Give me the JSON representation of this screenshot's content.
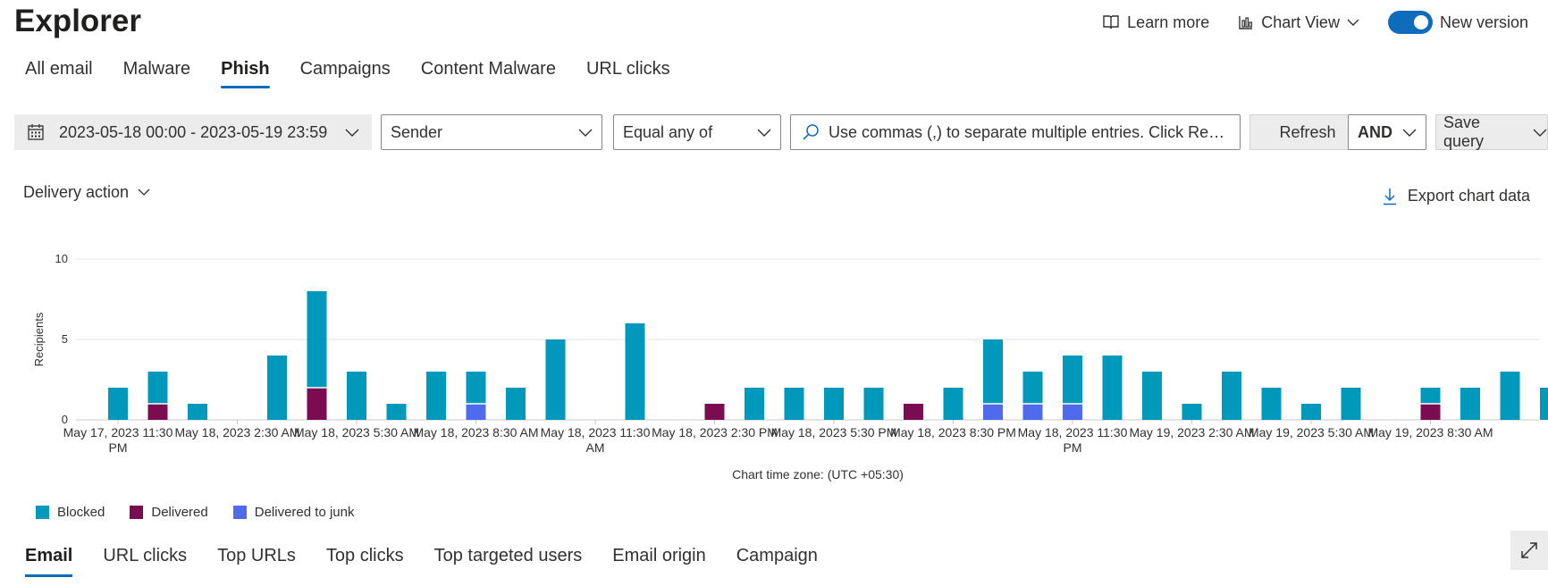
{
  "header": {
    "title": "Explorer"
  },
  "top_actions": {
    "learn_more": "Learn more",
    "chart_view": "Chart View",
    "new_version": "New version"
  },
  "tabs": [
    {
      "label": "All email"
    },
    {
      "label": "Malware"
    },
    {
      "label": "Phish",
      "active": true
    },
    {
      "label": "Campaigns"
    },
    {
      "label": "Content Malware"
    },
    {
      "label": "URL clicks"
    }
  ],
  "filters": {
    "date_range": "2023-05-18 00:00 - 2023-05-19 23:59",
    "field": "Sender",
    "operator": "Equal any of",
    "search_text": "Use commas (,) to separate multiple entries. Click Refresh to apply.",
    "refresh": "Refresh",
    "logic": "AND",
    "save_query": "Save query"
  },
  "chart_header": {
    "group_by": "Delivery action",
    "export": "Export chart data"
  },
  "colors": {
    "blocked": "#0199bb",
    "delivered": "#7a0d52",
    "delivered_to_junk": "#4f6bed",
    "accent": "#0f6cbd"
  },
  "chart_data": {
    "type": "bar",
    "stacked": true,
    "ylabel": "Recipients",
    "ylim": [
      0,
      10
    ],
    "yticks": [
      0,
      5,
      10
    ],
    "xtick_labels": [
      {
        "at": 0,
        "lines": [
          "May 17, 2023 11:30",
          "PM"
        ]
      },
      {
        "at": 3,
        "lines": [
          "May 18, 2023 2:30 AM"
        ]
      },
      {
        "at": 6,
        "lines": [
          "May 18, 2023 5:30 AM"
        ]
      },
      {
        "at": 9,
        "lines": [
          "May 18, 2023 8:30 AM"
        ]
      },
      {
        "at": 12,
        "lines": [
          "May 18, 2023 11:30",
          "AM"
        ]
      },
      {
        "at": 15,
        "lines": [
          "May 18, 2023 2:30 PM"
        ]
      },
      {
        "at": 18,
        "lines": [
          "May 18, 2023 5:30 PM"
        ]
      },
      {
        "at": 21,
        "lines": [
          "May 18, 2023 8:30 PM"
        ]
      },
      {
        "at": 24,
        "lines": [
          "May 18, 2023 11:30",
          "PM"
        ]
      },
      {
        "at": 27,
        "lines": [
          "May 19, 2023 2:30 AM"
        ]
      },
      {
        "at": 30,
        "lines": [
          "May 19, 2023 5:30 AM"
        ]
      },
      {
        "at": 33,
        "lines": [
          "May 19, 2023 8:30 AM"
        ]
      }
    ],
    "timezone_note": "Chart time zone: (UTC +05:30)",
    "categories": [
      "May 17 11:30 PM",
      "May 18 12:30 AM",
      "May 18 1:30 AM",
      "May 18 2:30 AM",
      "May 18 3:30 AM",
      "May 18 4:30 AM",
      "May 18 5:30 AM",
      "May 18 6:30 AM",
      "May 18 7:30 AM",
      "May 18 8:30 AM",
      "May 18 9:30 AM",
      "May 18 10:30 AM",
      "May 18 11:30 AM",
      "May 18 12:30 PM",
      "May 18 1:30 PM",
      "May 18 2:30 PM",
      "May 18 3:30 PM",
      "May 18 4:30 PM",
      "May 18 5:30 PM",
      "May 18 6:30 PM",
      "May 18 7:30 PM",
      "May 18 8:30 PM",
      "May 18 9:30 PM",
      "May 18 10:30 PM",
      "May 18 11:30 PM",
      "May 19 12:30 AM",
      "May 19 1:30 AM",
      "May 19 2:30 AM",
      "May 19 3:30 AM",
      "May 19 4:30 AM",
      "May 19 5:30 AM",
      "May 19 6:30 AM",
      "May 19 7:30 AM",
      "May 19 8:30 AM",
      "May 19 9:30 AM",
      "May 19 10:30 AM"
    ],
    "series": [
      {
        "name": "Blocked",
        "color": "#0199bb",
        "values": [
          2,
          2,
          1,
          0,
          4,
          6,
          3,
          1,
          3,
          2,
          2,
          5,
          0,
          6,
          0,
          0,
          2,
          2,
          2,
          2,
          0,
          2,
          4,
          2,
          3,
          4,
          3,
          1,
          3,
          2,
          1,
          2,
          0,
          1,
          2,
          3,
          2
        ]
      },
      {
        "name": "Delivered",
        "color": "#7a0d52",
        "values": [
          0,
          1,
          0,
          0,
          0,
          2,
          0,
          0,
          0,
          0,
          0,
          0,
          0,
          0,
          0,
          1,
          0,
          0,
          0,
          0,
          1,
          0,
          0,
          0,
          0,
          0,
          0,
          0,
          0,
          0,
          0,
          0,
          0,
          1,
          0,
          0,
          0
        ]
      },
      {
        "name": "Delivered to junk",
        "color": "#4f6bed",
        "values": [
          0,
          0,
          0,
          0,
          0,
          0,
          0,
          0,
          0,
          1,
          0,
          0,
          0,
          0,
          0,
          0,
          0,
          0,
          0,
          0,
          0,
          0,
          1,
          1,
          1,
          0,
          0,
          0,
          0,
          0,
          0,
          0,
          0,
          0,
          0,
          0,
          0
        ]
      }
    ],
    "legend": [
      "Blocked",
      "Delivered",
      "Delivered to junk"
    ],
    "legend_position": "bottom-left",
    "grid": true
  },
  "bottom_tabs": [
    {
      "label": "Email",
      "active": true
    },
    {
      "label": "URL clicks"
    },
    {
      "label": "Top URLs"
    },
    {
      "label": "Top clicks"
    },
    {
      "label": "Top targeted users"
    },
    {
      "label": "Email origin"
    },
    {
      "label": "Campaign"
    }
  ]
}
